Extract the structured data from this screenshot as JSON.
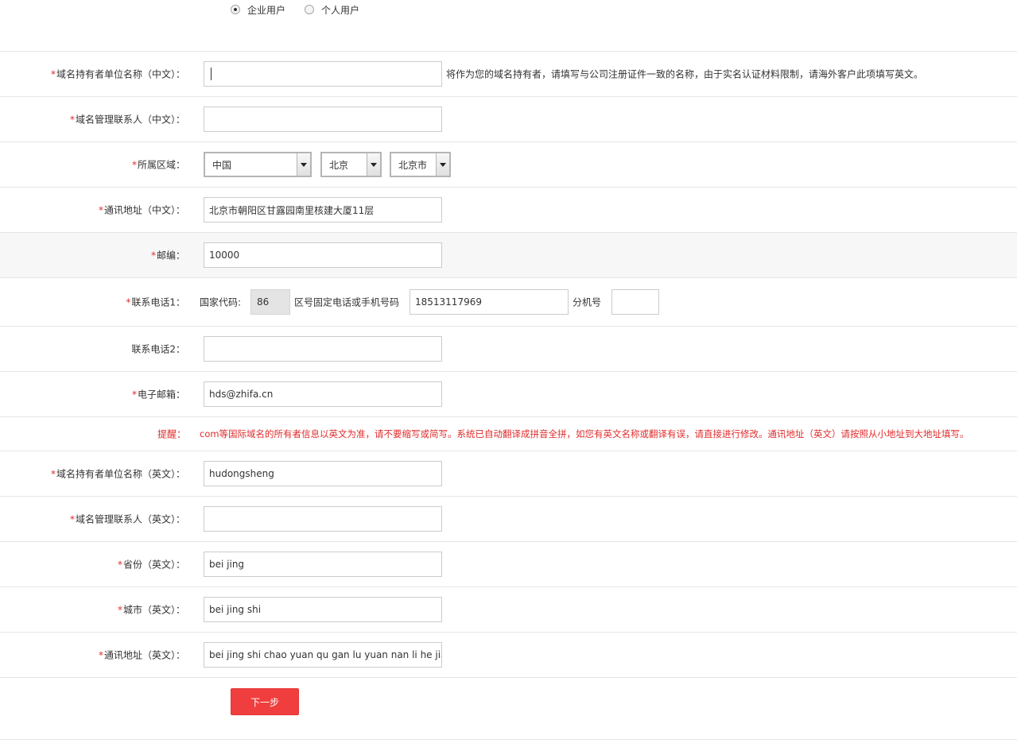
{
  "user_type": {
    "options": [
      {
        "label": "企业用户",
        "checked": true
      },
      {
        "label": "个人用户",
        "checked": false
      }
    ]
  },
  "required_mark": "*",
  "colors": {
    "accent": "#f03e3e",
    "required": "#e02b2b",
    "border": "#cccccc",
    "divider": "#e6e6e6",
    "shaded_row": "#f7f7f7"
  },
  "fields": {
    "org_name_cn": {
      "label": "域名持有者单位名称（中文）：",
      "value": "",
      "hint": "将作为您的域名持有者，请填写与公司注册证件一致的名称，由于实名认证材料限制，请海外客户此项填写英文。"
    },
    "contact_cn": {
      "label": "域名管理联系人（中文）：",
      "value": ""
    },
    "region": {
      "label": "所属区域：",
      "country": "中国",
      "province": "北京",
      "city": "北京市"
    },
    "address_cn": {
      "label": "通讯地址（中文）：",
      "value": "北京市朝阳区甘露园南里核建大厦11层"
    },
    "postcode": {
      "label": "邮编：",
      "value": "10000"
    },
    "phone1": {
      "label": "联系电话1：",
      "country_code_label": "国家代码:",
      "country_code": "86",
      "number_label": "区号固定电话或手机号码",
      "number": "18513117969",
      "ext_label": "分机号",
      "ext": ""
    },
    "phone2": {
      "label": "联系电话2：",
      "value": ""
    },
    "email": {
      "label": "电子邮箱：",
      "value": "hds@zhifa.cn"
    },
    "org_name_en": {
      "label": "域名持有者单位名称（英文）：",
      "value": "hudongsheng"
    },
    "contact_en": {
      "label": "域名管理联系人（英文）：",
      "value": ""
    },
    "province_en": {
      "label": "省份（英文）：",
      "value": "bei jing"
    },
    "city_en": {
      "label": "城市（英文）：",
      "value": "bei jing shi"
    },
    "address_en": {
      "label": "通讯地址（英文）：",
      "value": "bei jing shi chao yuan qu gan lu yuan nan li he jian"
    }
  },
  "notice": {
    "label": "提醒：",
    "text": "com等国际域名的所有者信息以英文为准，请不要缩写或简写。系统已自动翻译成拼音全拼，如您有英文名称或翻译有误，请直接进行修改。通讯地址（英文）请按照从小地址到大地址填写。"
  },
  "next_button": {
    "label": "下一步"
  }
}
